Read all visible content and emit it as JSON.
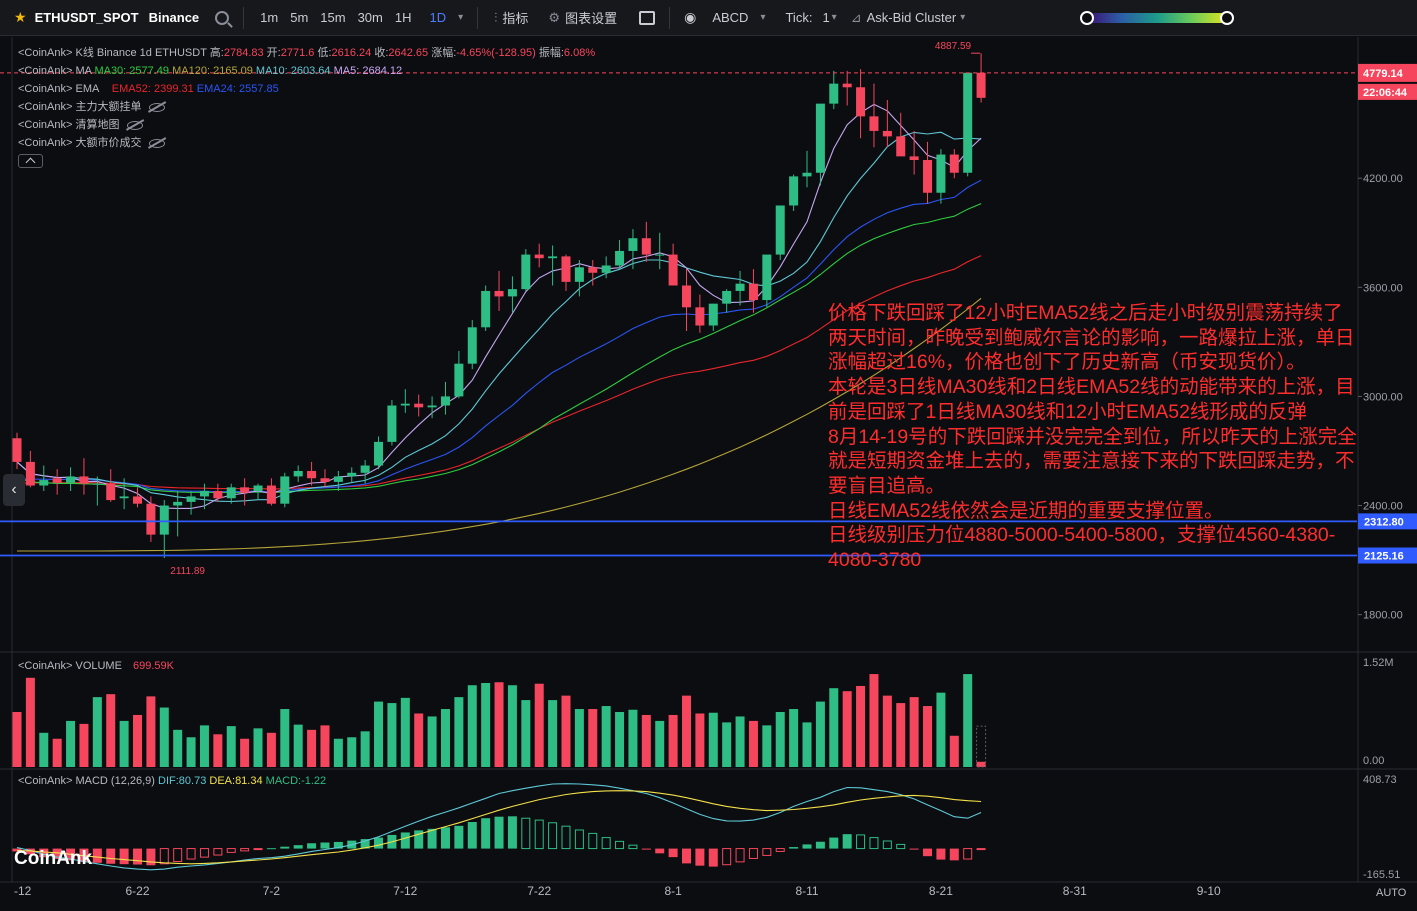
{
  "toolbar": {
    "symbol": "ETHUSDT_SPOT",
    "exchange": "Binance",
    "intervals": [
      "1m",
      "5m",
      "15m",
      "30m",
      "1H",
      "1D"
    ],
    "active_interval": "1D",
    "indicators_label": "指标",
    "chart_settings_label": "图表设置",
    "abcd_label": "ABCD",
    "tick_label": "Tick:",
    "tick_value": "1",
    "cluster_label": "Ask-Bid Cluster"
  },
  "legend": {
    "kline": {
      "prefix": "<CoinAnk> K线  Binance 1d ETHUSDT",
      "high_label": "高:",
      "high": "2784.83",
      "open_label": "开:",
      "open": "2771.6",
      "low_label": "低:",
      "low": "2616.24",
      "close_label": "收:",
      "close": "2642.65",
      "change_label": "涨幅:",
      "change": "-4.65%(-128.95)",
      "amplitude_label": "振幅:",
      "amplitude": "6.08%"
    },
    "ma": {
      "prefix": "<CoinAnk> MA",
      "ma30": "MA30: 2577.49",
      "ma120": "MA120: 2165.09",
      "ma10": "MA10: 2603.64",
      "ma5": "MA5: 2684.12"
    },
    "ema": {
      "prefix": "<CoinAnk> EMA",
      "ema52": "EMA52: 2399.31",
      "ema24": "EMA24: 2557.85"
    },
    "orders": "<CoinAnk> 主力大额挂单",
    "liquidation": "<CoinAnk> 清算地图",
    "large_trades": "<CoinAnk> 大额市价成交"
  },
  "volume_legend": {
    "label": "<CoinAnk> VOLUME",
    "value": "699.59K"
  },
  "macd_legend": {
    "label": "<CoinAnk> MACD  (12,26,9)",
    "dif": "DIF:80.73",
    "dea": "DEA:81.34",
    "macd": "MACD:-1.22"
  },
  "price_axis": {
    "ticks": [
      "4200.00",
      "3600.00",
      "3000.00",
      "2400.00",
      "1800.00"
    ]
  },
  "volume_axis": {
    "ticks": [
      "1.52M",
      "0.00"
    ]
  },
  "macd_axis": {
    "ticks": [
      "408.73",
      "-165.51"
    ]
  },
  "time_axis": {
    "ticks": [
      "-12",
      "6-22",
      "7-2",
      "7-12",
      "7-22",
      "8-1",
      "8-11",
      "8-21",
      "8-31",
      "9-10"
    ]
  },
  "price_labels": {
    "current": "4779.14",
    "countdown": "22:06:44",
    "line1": "2312.80",
    "line2": "2125.16"
  },
  "annotations": {
    "high_mark": "4887.59",
    "low_mark": "2111.89"
  },
  "annotation_text": "价格下跌回踩了12小时EMA52线之后走小时级别震荡持续了两天时间，昨晚受到鲍威尔言论的影响，一路爆拉上涨，单日涨幅超过16%，价格也创下了历史新高（币安现货价）。\n本轮是3日线MA30线和2日线EMA52线的动能带来的上涨，目前是回踩了1日线MA30线和12小时EMA52线形成的反弹\n8月14-19号的下跌回踩并没完完全到位，所以昨天的上涨完全就是短期资金堆上去的，需要注意接下来的下跌回踩走势，不要盲目追高。\n日线EMA52线依然会是近期的重要支撑位置。\n日线级别压力位4880-5000-5400-5800，支撑位4560-4380-4080-3780",
  "watermark": "CoinAnk",
  "auto_label": "AUTO",
  "colors": {
    "up": "#2ebd85",
    "down": "#f6465d",
    "ma5": "#c6a6f2",
    "ma10": "#5ec8d6",
    "ema24": "#2a55f5",
    "ma30": "#2ecc40",
    "ema52": "#e8262c",
    "ma120": "#b5a43a",
    "hline": "#2f5bff",
    "dif": "#5ec8d6",
    "dea": "#f3e04a",
    "annotation": "#ff2d2d"
  },
  "chart_data": {
    "type": "candlestick",
    "symbol": "ETHUSDT",
    "interval": "1d",
    "x": [
      "6-12",
      "6-13",
      "6-14",
      "6-15",
      "6-16",
      "6-17",
      "6-18",
      "6-19",
      "6-20",
      "6-21",
      "6-22",
      "6-23",
      "6-24",
      "6-25",
      "6-26",
      "6-27",
      "6-28",
      "6-29",
      "6-30",
      "7-1",
      "7-2",
      "7-3",
      "7-4",
      "7-5",
      "7-6",
      "7-7",
      "7-8",
      "7-9",
      "7-10",
      "7-11",
      "7-12",
      "7-13",
      "7-14",
      "7-15",
      "7-16",
      "7-17",
      "7-18",
      "7-19",
      "7-20",
      "7-21",
      "7-22",
      "7-23",
      "7-24",
      "7-25",
      "7-26",
      "7-27",
      "7-28",
      "7-29",
      "7-30",
      "7-31",
      "8-1",
      "8-2",
      "8-3",
      "8-4",
      "8-5",
      "8-6",
      "8-7",
      "8-8",
      "8-9",
      "8-10",
      "8-11",
      "8-12",
      "8-13",
      "8-14",
      "8-15",
      "8-16",
      "8-17",
      "8-18",
      "8-19",
      "8-20",
      "8-21",
      "8-22",
      "8-23"
    ],
    "open": [
      2770,
      2640,
      2510,
      2550,
      2525,
      2560,
      2520,
      2520,
      2440,
      2450,
      2410,
      2240,
      2400,
      2420,
      2450,
      2480,
      2440,
      2500,
      2480,
      2510,
      2410,
      2560,
      2590,
      2550,
      2530,
      2560,
      2580,
      2620,
      2750,
      2950,
      2960,
      2940,
      2950,
      3000,
      3180,
      3380,
      3580,
      3550,
      3590,
      3780,
      3760,
      3770,
      3630,
      3710,
      3680,
      3720,
      3800,
      3870,
      3780,
      3780,
      3610,
      3490,
      3390,
      3510,
      3580,
      3620,
      3530,
      3780,
      4050,
      4210,
      4230,
      4610,
      4720,
      4700,
      4540,
      4460,
      4430,
      4320,
      4300,
      4120,
      4330,
      4230,
      4780
    ],
    "high": [
      2800,
      2700,
      2620,
      2600,
      2610,
      2660,
      2560,
      2600,
      2550,
      2500,
      2450,
      2430,
      2480,
      2480,
      2520,
      2520,
      2520,
      2550,
      2520,
      2550,
      2580,
      2620,
      2640,
      2600,
      2590,
      2610,
      2650,
      2780,
      2980,
      3040,
      3010,
      3000,
      3080,
      3250,
      3420,
      3610,
      3690,
      3660,
      3810,
      3840,
      3830,
      3780,
      3750,
      3750,
      3770,
      3860,
      3920,
      3960,
      3900,
      3840,
      3700,
      3560,
      3510,
      3590,
      3690,
      3700,
      3710,
      3940,
      4220,
      4350,
      4340,
      4790,
      4790,
      4800,
      4720,
      4630,
      4560,
      4460,
      4400,
      4360,
      4360,
      4380,
      4887
    ],
    "low": [
      2600,
      2500,
      2480,
      2460,
      2480,
      2460,
      2400,
      2420,
      2380,
      2390,
      2200,
      2111,
      2230,
      2350,
      2380,
      2420,
      2410,
      2400,
      2430,
      2400,
      2390,
      2530,
      2510,
      2500,
      2480,
      2530,
      2520,
      2600,
      2730,
      2910,
      2890,
      2880,
      2900,
      2990,
      3150,
      3360,
      3470,
      3460,
      3580,
      3710,
      3610,
      3580,
      3550,
      3610,
      3650,
      3700,
      3700,
      3740,
      3700,
      3680,
      3360,
      3350,
      3360,
      3460,
      3500,
      3460,
      3490,
      3750,
      4020,
      4150,
      4160,
      4580,
      4600,
      4420,
      4370,
      4370,
      4380,
      4220,
      4060,
      4060,
      4200,
      4210,
      4616
    ],
    "close": [
      2640,
      2510,
      2540,
      2525,
      2560,
      2520,
      2520,
      2430,
      2450,
      2410,
      2240,
      2400,
      2420,
      2450,
      2480,
      2440,
      2500,
      2470,
      2510,
      2410,
      2560,
      2590,
      2550,
      2530,
      2560,
      2580,
      2620,
      2750,
      2950,
      2960,
      2940,
      2950,
      3000,
      3180,
      3380,
      3580,
      3550,
      3590,
      3780,
      3760,
      3770,
      3630,
      3710,
      3680,
      3720,
      3800,
      3870,
      3780,
      3780,
      3610,
      3490,
      3390,
      3510,
      3580,
      3620,
      3530,
      3780,
      4050,
      4210,
      4230,
      4610,
      4720,
      4700,
      4540,
      4460,
      4430,
      4320,
      4300,
      4120,
      4330,
      4230,
      4780,
      4642
    ],
    "volume": [
      0.74,
      1.2,
      0.46,
      0.38,
      0.62,
      0.58,
      0.94,
      0.98,
      0.62,
      0.7,
      0.95,
      0.8,
      0.5,
      0.4,
      0.56,
      0.44,
      0.55,
      0.38,
      0.52,
      0.46,
      0.78,
      0.57,
      0.5,
      0.56,
      0.38,
      0.4,
      0.48,
      0.88,
      0.86,
      0.93,
      0.72,
      0.68,
      0.78,
      0.94,
      1.1,
      1.13,
      1.14,
      1.1,
      0.9,
      1.12,
      0.9,
      0.96,
      0.78,
      0.78,
      0.82,
      0.74,
      0.77,
      0.7,
      0.62,
      0.7,
      0.96,
      0.72,
      0.73,
      0.6,
      0.68,
      0.62,
      0.56,
      0.74,
      0.78,
      0.6,
      0.88,
      1.06,
      1.02,
      1.09,
      1.25,
      0.96,
      0.86,
      0.94,
      0.82,
      1.0,
      0.42,
      1.25,
      0.07
    ],
    "volume_unit": "M",
    "ylim": [
      1600,
      4960
    ],
    "volume_ylim": [
      0,
      1.52
    ],
    "macd_ylim": [
      -165.51,
      408.73
    ],
    "macd_histogram": [
      -15,
      -30,
      -45,
      -55,
      -62,
      -70,
      -75,
      -80,
      -82,
      -84,
      -88,
      -80,
      -68,
      -55,
      -45,
      -34,
      -20,
      -12,
      -5,
      2,
      10,
      18,
      28,
      32,
      35,
      42,
      50,
      58,
      72,
      85,
      96,
      104,
      112,
      120,
      140,
      160,
      168,
      170,
      160,
      150,
      136,
      118,
      98,
      80,
      58,
      38,
      18,
      -5,
      -25,
      -45,
      -78,
      -90,
      -95,
      -85,
      -70,
      -52,
      -36,
      -15,
      8,
      22,
      36,
      58,
      76,
      72,
      58,
      40,
      22,
      -5,
      -40,
      -58,
      -62,
      -55,
      -1.22
    ],
    "macd_dif": [
      5,
      -10,
      -30,
      -45,
      -55,
      -68,
      -80,
      -92,
      -102,
      -108,
      -112,
      -108,
      -98,
      -92,
      -86,
      -78,
      -70,
      -60,
      -52,
      -48,
      -40,
      -28,
      -15,
      -5,
      5,
      20,
      40,
      62,
      90,
      118,
      145,
      170,
      192,
      215,
      240,
      265,
      290,
      305,
      318,
      330,
      340,
      342,
      340,
      336,
      330,
      318,
      305,
      290,
      268,
      240,
      210,
      180,
      158,
      146,
      145,
      150,
      165,
      190,
      222,
      248,
      270,
      300,
      322,
      320,
      310,
      300,
      284,
      262,
      230,
      200,
      168,
      160,
      190
    ],
    "macd_dea": [
      -10,
      -12,
      -18,
      -22,
      -30,
      -38,
      -45,
      -52,
      -58,
      -64,
      -70,
      -75,
      -78,
      -80,
      -78,
      -75,
      -70,
      -65,
      -60,
      -55,
      -48,
      -40,
      -32,
      -25,
      -18,
      -8,
      4,
      18,
      35,
      55,
      76,
      96,
      116,
      136,
      158,
      180,
      202,
      222,
      240,
      258,
      272,
      285,
      294,
      300,
      304,
      305,
      304,
      300,
      292,
      282,
      268,
      252,
      236,
      222,
      212,
      205,
      200,
      202,
      206,
      212,
      220,
      230,
      244,
      256,
      265,
      272,
      278,
      280,
      276,
      268,
      258,
      252,
      248
    ],
    "horizontal_lines": [
      2312.8,
      2125.16
    ],
    "current_price": 4779.14,
    "high_marker": 4887.59,
    "low_marker": 2111.89
  }
}
